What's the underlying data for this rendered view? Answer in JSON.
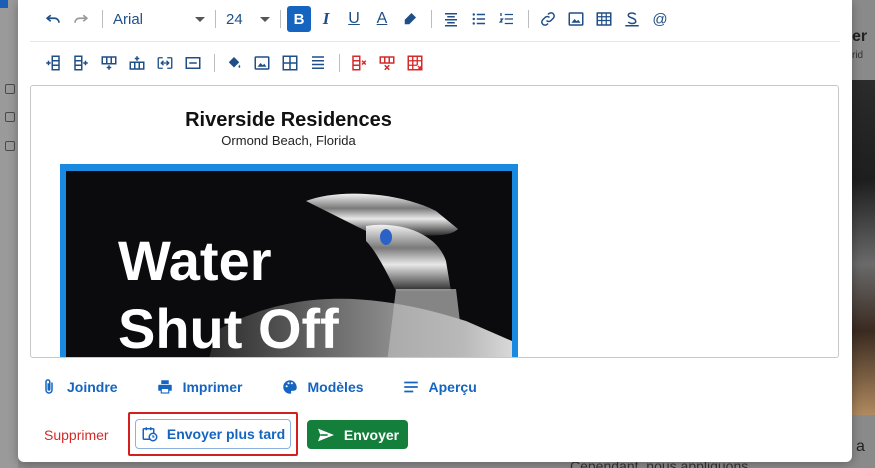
{
  "toolbar": {
    "font_family": "Arial",
    "font_size": "24",
    "bold_label": "B",
    "italic_label": "I",
    "underline_label": "U",
    "font_color_label": "A",
    "mention_label": "@"
  },
  "document": {
    "title": "Riverside Residences",
    "subtitle": "Ormond Beach, Florida",
    "flyer_line1": "Water",
    "flyer_line2": "Shut Off"
  },
  "actions": {
    "attach": "Joindre",
    "print": "Imprimer",
    "templates": "Modèles",
    "preview": "Aperçu"
  },
  "footer": {
    "delete": "Supprimer",
    "send_later": "Envoyer plus tard",
    "send": "Envoyer"
  },
  "background": {
    "right_title_fragment": "er",
    "right_sub_fragment": "rid",
    "right_bottom_fragment": "a",
    "bottom_text_fragment": "Cependant, nous appliquons"
  },
  "colors": {
    "accent": "#1565c0",
    "send_button": "#137f3b",
    "danger": "#d42a2a",
    "highlight_box": "#d41f1f",
    "flyer_border": "#1a8ae0"
  }
}
